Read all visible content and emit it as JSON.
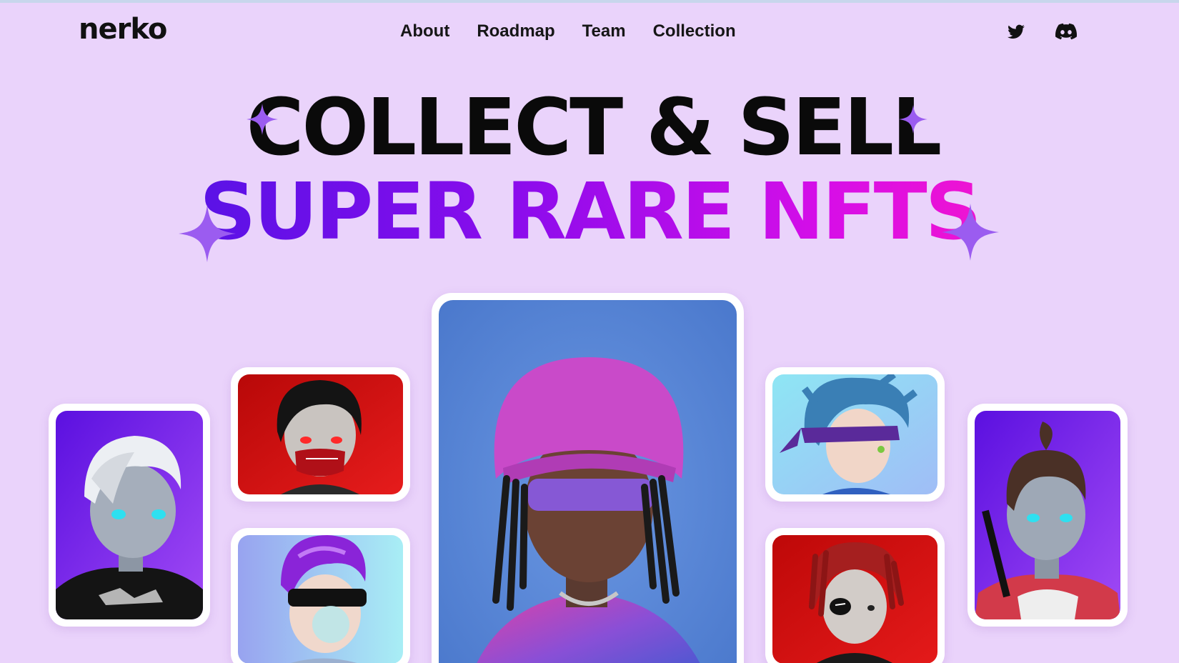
{
  "brand": {
    "logo_text": "nerko"
  },
  "nav": {
    "items": [
      "About",
      "Roadmap",
      "Team",
      "Collection"
    ]
  },
  "social": {
    "twitter_icon": "twitter-icon",
    "discord_icon": "discord-icon"
  },
  "hero": {
    "line1": "COLLECT & SELL",
    "line2": "SUPER RARE NFTS",
    "gradient_colors": [
      "#5a12e6",
      "#8a0cec",
      "#d60ee8",
      "#ee14d2"
    ],
    "sparkle_color": "#9b5cf0"
  },
  "gallery": {
    "cards": [
      {
        "name": "nft-card-white-hair-android",
        "bg": [
          "#6a1bea",
          "#9a3cf5"
        ]
      },
      {
        "name": "nft-card-masked-red",
        "bg": [
          "#c80a0a",
          "#e21a1a"
        ]
      },
      {
        "name": "nft-card-purple-hair-bubblegum",
        "bg": [
          "#9aa7f2",
          "#a6ecf5"
        ]
      },
      {
        "name": "nft-card-featured-pink-beanie",
        "bg": [
          "#5d8bdc",
          "#4a78cf"
        ]
      },
      {
        "name": "nft-card-blue-hair-blindfold",
        "bg": [
          "#8fe3f3",
          "#9ec0f5"
        ]
      },
      {
        "name": "nft-card-red-dreads-eyepatch",
        "bg": [
          "#c80a0a",
          "#e01818"
        ]
      },
      {
        "name": "nft-card-ponytail-android",
        "bg": [
          "#6a1bea",
          "#9a3cf5"
        ]
      }
    ]
  },
  "colors": {
    "page_bg": "#ead3fb",
    "card_border": "#ffffff",
    "text_dark": "#111111"
  }
}
